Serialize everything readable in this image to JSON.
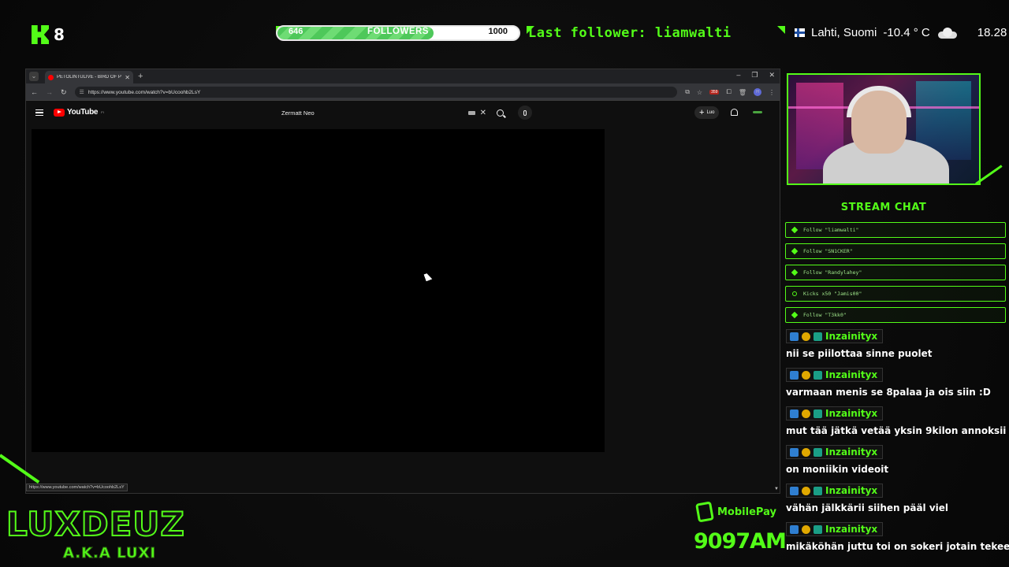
{
  "overlay": {
    "kick_viewers": "8",
    "followers": {
      "current": "646",
      "label": "FOLLOWERS",
      "goal": "1000",
      "progress": 0.646
    },
    "last_follower": "Last follower: liamwalti",
    "weather": {
      "location": "Lahti, Suomi",
      "temperature": "-10.4 ° C",
      "time": "18.28"
    },
    "accent_color": "#53fc18"
  },
  "browser": {
    "tab_title": "PETOLINTULIVE - BIRD OF PREY",
    "url": "https://www.youtube.com/watch?v=bUcoohb2LsY",
    "status_url": "https://www.youtube.com/watch?v=bUcoohb2LsY",
    "extension_badge": "359",
    "profile_initial": "H"
  },
  "youtube": {
    "logo_text": "YouTube",
    "region": "FI",
    "search_query": "Zermatt Neo",
    "create_label": "Luo"
  },
  "chat": {
    "title": "STREAM CHAT",
    "events": [
      {
        "icon": "heart-icon",
        "text": "Follow \"liamwalti\""
      },
      {
        "icon": "heart-icon",
        "text": "Follow \"SN1CKER\""
      },
      {
        "icon": "heart-icon",
        "text": "Follow \"Randylahey\""
      },
      {
        "icon": "kick-coin-icon",
        "text": "Kicks x50 \"Jamis00\""
      },
      {
        "icon": "heart-icon",
        "text": "Follow \"T3kk0\""
      }
    ],
    "messages": [
      {
        "user": "Inzainityx",
        "text": "nii se piilottaa sinne puolet"
      },
      {
        "user": "Inzainityx",
        "text": "varmaan menis se 8palaa ja ois siin :D"
      },
      {
        "user": "Inzainityx",
        "text": "mut tää jätkä vetää yksin 9kilon annoksii"
      },
      {
        "user": "Inzainityx",
        "text": "on moniikin videoit"
      },
      {
        "user": "Inzainityx",
        "text": "vähän jälkkärii siihen pääl viel"
      },
      {
        "user": "Inzainityx",
        "text": "mikäköhän juttu toi on sokeri jotain tekee"
      }
    ]
  },
  "brand": {
    "name": "LUXDEUZ",
    "sub": "A.K.A LUXI"
  },
  "donation": {
    "label": "MobilePay",
    "number": "9097AM"
  }
}
